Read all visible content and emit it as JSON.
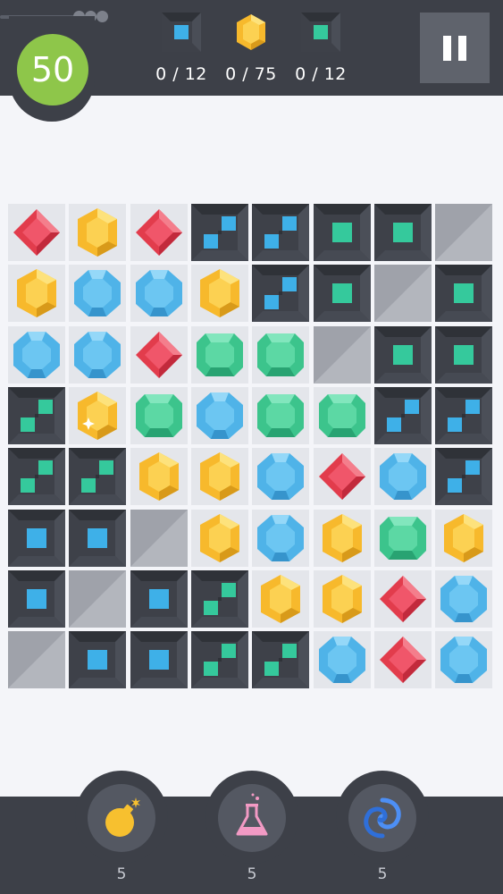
{
  "header": {
    "moves_left": "50",
    "goals": [
      {
        "icon": "blue-tile-icon",
        "count": "0 / 12"
      },
      {
        "icon": "yellow-gem-icon",
        "count": "0 / 75"
      },
      {
        "icon": "green-tile-icon",
        "count": "0 / 12"
      }
    ],
    "pause_icon": "pause-icon"
  },
  "board": {
    "rows": [
      [
        "red",
        "yellow",
        "red",
        "blocker-blue",
        "blocker-blue",
        "tile-green",
        "tile-green",
        "empty"
      ],
      [
        "yellow",
        "blue",
        "blue",
        "yellow",
        "blocker-blue",
        "tile-green",
        "empty",
        "tile-green"
      ],
      [
        "blue",
        "blue",
        "red",
        "green",
        "green",
        "empty",
        "tile-green",
        "tile-green"
      ],
      [
        "blocker-green",
        "yellow-sparkle",
        "green",
        "blue",
        "green",
        "green",
        "blocker-blue",
        "blocker-blue"
      ],
      [
        "blocker-green",
        "blocker-green",
        "yellow",
        "yellow",
        "blue",
        "red",
        "blue",
        "blocker-blue"
      ],
      [
        "tile-blue",
        "tile-blue",
        "empty",
        "yellow",
        "blue",
        "yellow",
        "green",
        "yellow"
      ],
      [
        "tile-blue",
        "empty",
        "tile-blue",
        "blocker-green",
        "yellow",
        "yellow",
        "red",
        "blue"
      ],
      [
        "empty",
        "tile-blue",
        "tile-blue",
        "blocker-green",
        "blocker-green",
        "blue",
        "red",
        "blue"
      ]
    ]
  },
  "powerups": [
    {
      "name": "bomb",
      "icon": "bomb-icon",
      "count": "5"
    },
    {
      "name": "potion",
      "icon": "flask-icon",
      "count": "5"
    },
    {
      "name": "vortex",
      "icon": "vortex-icon",
      "count": "5"
    }
  ],
  "colors": {
    "bar": "#3d4048",
    "moves_circle": "#8ec64a",
    "red": "#e23c4c",
    "yellow": "#f7b92c",
    "blue": "#4fb3e8",
    "green": "#3cc48c",
    "tile_dark": "#3e4149",
    "tile_blue": "#3eb0e8",
    "tile_green": "#35c99c"
  }
}
